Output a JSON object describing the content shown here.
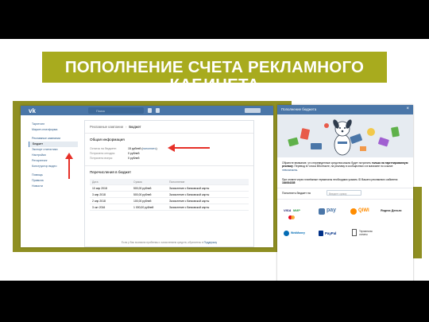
{
  "title": "ПОПОЛНЕНИЕ СЧЕТА РЕКЛАМНОГО КАБИНЕТА",
  "colors": {
    "banner": "#a8ab1e",
    "olive_block": "#8f8f22",
    "vk_blue": "#4a76a8",
    "arrow": "#e63028"
  },
  "left_screenshot": {
    "header": {
      "search": "Поиск"
    },
    "sidebar": {
      "items": [
        {
          "label": "Таргетинг"
        },
        {
          "label": "Маркет-платформа"
        },
        {
          "label": "Рекламные кампании"
        },
        {
          "label": "Бюджет",
          "active": true
        },
        {
          "label": "Экспорт статистики"
        },
        {
          "label": "Настройки"
        },
        {
          "label": "Ретаргетинг"
        },
        {
          "label": "Конструктор видео"
        },
        {
          "label": "Помощь"
        },
        {
          "label": "Правила"
        },
        {
          "label": "Новости"
        }
      ]
    },
    "breadcrumb": {
      "parent": "Рекламные кампании",
      "current": "Бюджет"
    },
    "general": {
      "heading": "Общая информация",
      "rows": [
        {
          "label": "Остаток на бюджете:",
          "value": "15 рублей",
          "link": "пополнить"
        },
        {
          "label": "Потрачено сегодня:",
          "value": "0 рублей"
        },
        {
          "label": "Потрачено вчера:",
          "value": "0 рублей"
        }
      ]
    },
    "transfers": {
      "heading": "Перечисления в бюджет",
      "columns": [
        "Дата",
        "Сумма",
        "Пополнение"
      ],
      "rows": [
        [
          "10 апр 2018",
          "500,00 рублей",
          "Зачисление с банковской карты"
        ],
        [
          "3 апр 2018",
          "500,00 рублей",
          "Зачисление с банковской карты"
        ],
        [
          "2 апр 2018",
          "100,00 рублей",
          "Зачисление с банковской карты"
        ],
        [
          "3 окт 2016",
          "1 000,00 рублей",
          "Зачисление с банковской карты"
        ]
      ]
    },
    "footer": {
      "text": "Если у Вас возникли проблемы с зачислением средств, обратитесь в",
      "link": "Поддержку"
    }
  },
  "right_screenshot": {
    "modal_title": "Пополнение бюджета",
    "paragraph1": {
      "text": "Обратите внимание, что переведенные средства можно будет потратить ",
      "bold": "только на таргетированную рекламу",
      "rest": ". Перевод в Голоса ВКонтакте, на рекламу в сообществах и в магазине по ссылке ",
      "link": "невозможны",
      "end": "."
    },
    "paragraph2": {
      "text": "При оплате через платёжные терминалы необходимо указать ID Вашего рекламного кабинета:",
      "bold": "164934335"
    },
    "amount": {
      "label": "Пополнить бюджет на",
      "placeholder": "Введите сумму"
    },
    "payments": [
      "VISA",
      "МИР",
      "pay",
      "QIWI",
      "Яндекс Деньги",
      "WebMoney",
      "PayPal",
      "Терминалы оплаты"
    ]
  }
}
